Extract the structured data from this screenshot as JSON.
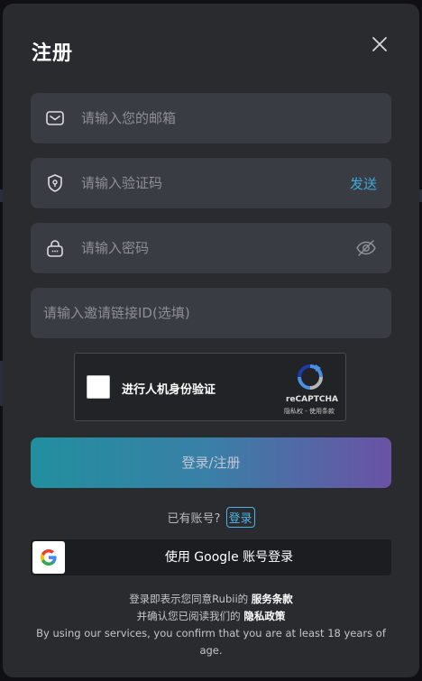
{
  "modal": {
    "title": "注册"
  },
  "form": {
    "email_placeholder": "请输入您的邮箱",
    "code_placeholder": "请输入验证码",
    "send_label": "发送",
    "password_placeholder": "请输入密码",
    "invite_placeholder": "请输入邀请链接ID(选填)"
  },
  "captcha": {
    "label": "进行人机身份验证",
    "brand": "reCAPTCHA",
    "links": "隐私权 - 使用条款"
  },
  "submit_label": "登录/注册",
  "account": {
    "prompt": "已有账号?",
    "login_label": "登录"
  },
  "google": {
    "label": "使用 Google 账号登录"
  },
  "terms": {
    "line1_prefix": "登录即表示您同意Rubii的",
    "service_terms": "服务条款",
    "line2_prefix": "并确认您已阅读我们的",
    "privacy_policy": "隐私政策",
    "age_notice": "By using our services, you confirm that you are at least 18 years of age."
  },
  "colors": {
    "modal_bg": "#2a2b2f",
    "field_bg": "#3a3c43",
    "accent": "#3fa9d8",
    "gradient_start": "#218f9e",
    "gradient_end": "#6a52a5"
  },
  "icons": [
    "close-icon",
    "mail-icon",
    "shield-icon",
    "lock-icon",
    "eye-off-icon",
    "recaptcha-icon",
    "google-icon"
  ]
}
